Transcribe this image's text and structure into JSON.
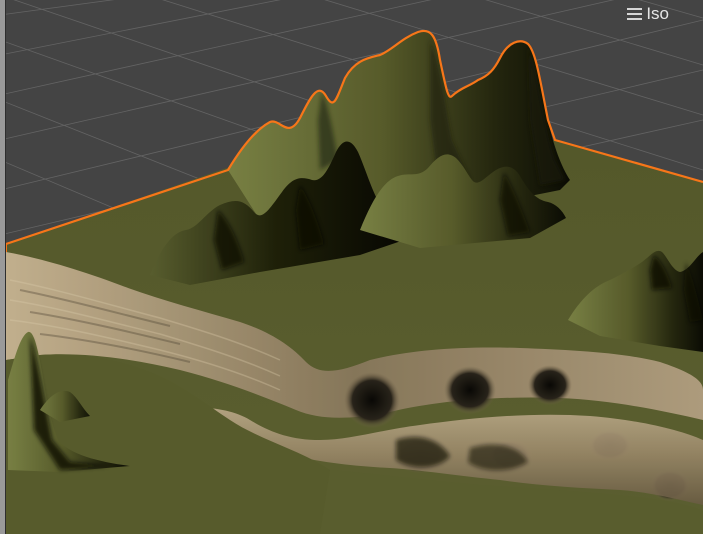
{
  "toolbar": {
    "view_mode_label": "Iso",
    "menu_icon": "hamburger-menu-icon"
  },
  "scene": {
    "grid": true,
    "colors": {
      "background": "#474747",
      "grid_line": "#8c8c8c",
      "terrain_ground": "#5b5f30",
      "terrain_shadow": "#111208",
      "terrain_highlight": "#7e8648",
      "rock_sand": "#b9a684",
      "selection_outline": "#ff7a1a",
      "left_border": "#9a9a9a"
    }
  }
}
